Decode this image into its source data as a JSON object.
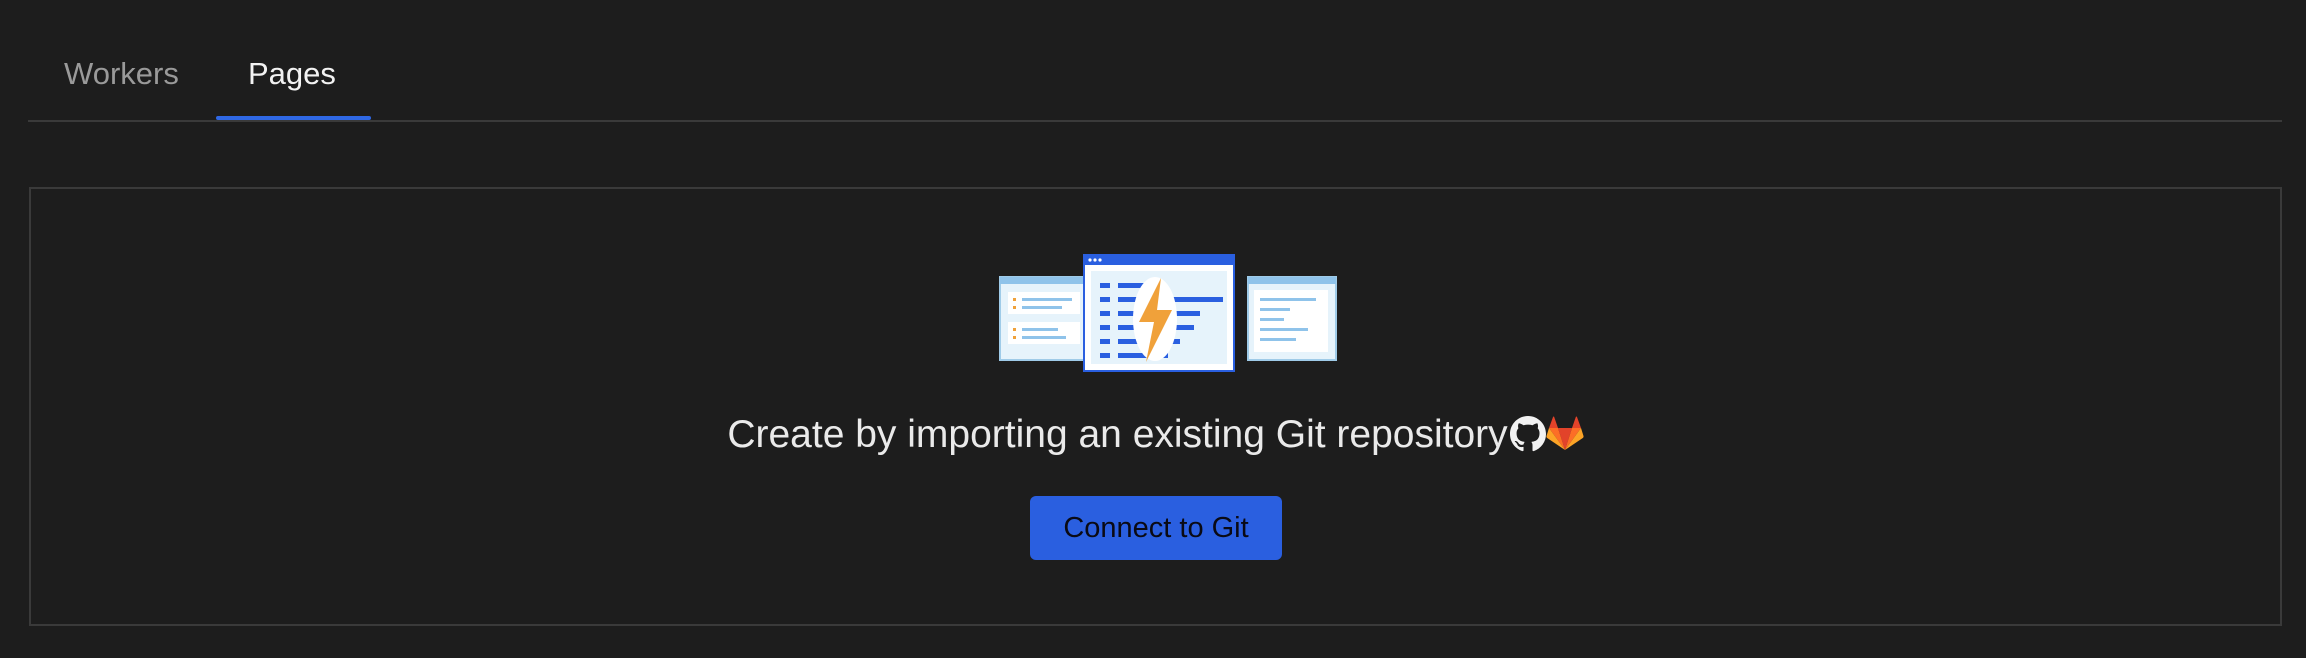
{
  "tabs": [
    {
      "label": "Workers",
      "active": false
    },
    {
      "label": "Pages",
      "active": true
    }
  ],
  "empty_state": {
    "heading": "Create by importing an existing Git repository",
    "icons": [
      "github-icon",
      "gitlab-icon"
    ],
    "button_label": "Connect to Git"
  },
  "colors": {
    "background": "#1d1d1d",
    "accent": "#2f68e4",
    "button": "#2a5fe0",
    "border": "#3a3a3a",
    "bolt": "#f0a13a",
    "gitlab": "#e2432a"
  }
}
